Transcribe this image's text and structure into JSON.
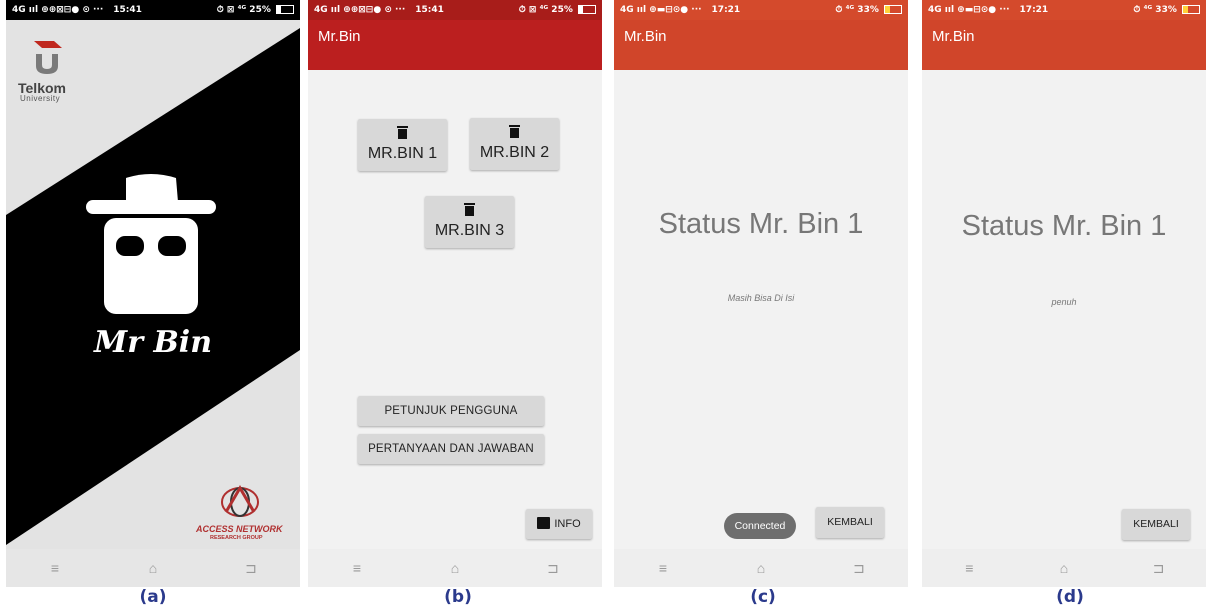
{
  "colors": {
    "app_bar": "#c0281f",
    "background": "#f2f2f2",
    "button": "#d8d8d8",
    "caption": "#2b3a8c"
  },
  "panels": [
    {
      "caption": "(a)",
      "status_bar": {
        "left": "4G ııl ⊕⊕⊠⊟● ⊙ ···",
        "time": "15:41",
        "right": "⏱ ⊠ ⁴ᴳ 25%"
      },
      "splash": {
        "university_name": "Telkom",
        "university_sub": "University",
        "app_name": "Mr Bin",
        "group_name": "ACCESS NETWORK",
        "group_sub": "RESEARCH GROUP"
      }
    },
    {
      "caption": "(b)",
      "status_bar": {
        "left": "4G ııl ⊕⊕⊠⊟● ⊙ ···",
        "time": "15:41",
        "right": "⏱ ⊠ ⁴ᴳ 25%"
      },
      "app_title": "Mr.Bin",
      "bins": [
        "MR.BIN 1",
        "MR.BIN 2",
        "MR.BIN 3"
      ],
      "buttons": [
        "PETUNJUK PENGGUNA",
        "PERTANYAAN DAN JAWABAN"
      ],
      "info_label": "INFO"
    },
    {
      "caption": "(c)",
      "status_bar": {
        "left": "4G ııl ⊕▬⊟⊙● ···",
        "time": "17:21",
        "right": "⏱ ⁴ᴳ 33%"
      },
      "app_title": "Mr.Bin",
      "status_title": "Status Mr. Bin 1",
      "status_text": "Masih Bisa Di Isi",
      "toast": "Connected",
      "back_label": "KEMBALI"
    },
    {
      "caption": "(d)",
      "status_bar": {
        "left": "4G ııl ⊕▬⊟⊙● ···",
        "time": "17:21",
        "right": "⏱ ⁴ᴳ 33%"
      },
      "app_title": "Mr.Bin",
      "status_title": "Status Mr. Bin 1",
      "status_text": "penuh",
      "back_label": "KEMBALI"
    }
  ]
}
